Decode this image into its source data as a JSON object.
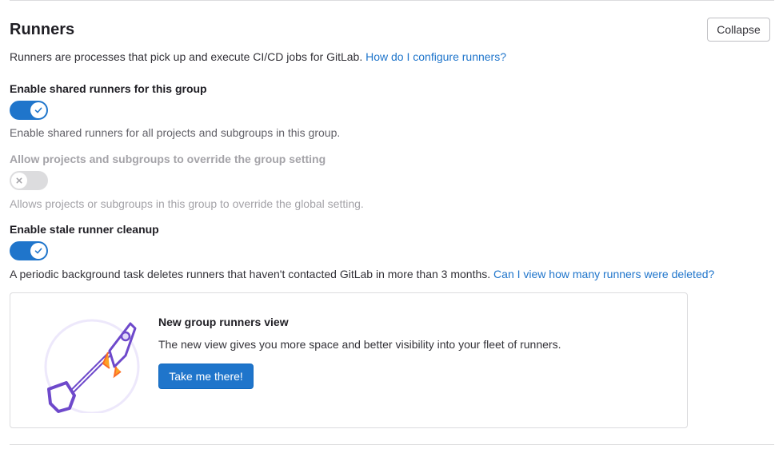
{
  "section": {
    "title": "Runners",
    "collapse_label": "Collapse",
    "description": "Runners are processes that pick up and execute CI/CD jobs for GitLab.",
    "description_link": "How do I configure runners?"
  },
  "settings": {
    "shared_runners": {
      "label": "Enable shared runners for this group",
      "enabled": true,
      "help": "Enable shared runners for all projects and subgroups in this group."
    },
    "override": {
      "label": "Allow projects and subgroups to override the group setting",
      "enabled": false,
      "disabled": true,
      "help": "Allows projects or subgroups in this group to override the global setting."
    },
    "stale_cleanup": {
      "label": "Enable stale runner cleanup",
      "enabled": true,
      "help": "A periodic background task deletes runners that haven't contacted GitLab in more than 3 months.",
      "help_link": "Can I view how many runners were deleted?"
    }
  },
  "promo": {
    "title": "New group runners view",
    "body": "The new view gives you more space and better visibility into your fleet of runners.",
    "button": "Take me there!",
    "illustration_icon": "rocket-illustration"
  },
  "colors": {
    "primary": "#1f75cb",
    "toggle_off": "#dcdcde",
    "text_disabled": "#a4a3a8",
    "illustration_purple": "#6e49cb"
  }
}
